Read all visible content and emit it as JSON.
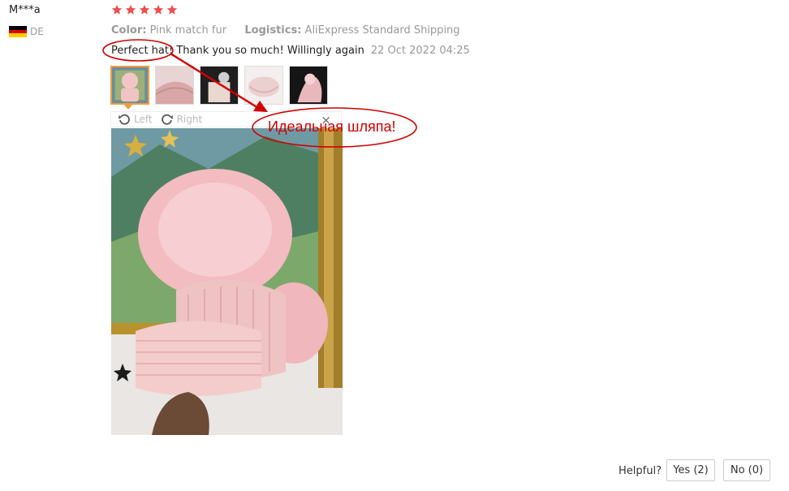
{
  "reviewer": {
    "name": "M***a",
    "country_code": "DE",
    "flag_colors": [
      "#000000",
      "#dd0000",
      "#ffce00"
    ]
  },
  "rating": {
    "stars": 5,
    "max": 5,
    "color": "#f04d4d"
  },
  "meta": {
    "color_label": "Color:",
    "color_value": "Pink match fur",
    "logistics_label": "Logistics:",
    "logistics_value": "AliExpress Standard Shipping"
  },
  "review": {
    "text": "Perfect hat! Thank you so much! Willingly again",
    "date": "22 Oct 2022 04:25"
  },
  "viewer": {
    "rotate_left": "Left",
    "rotate_right": "Right",
    "close": "×"
  },
  "annotation": {
    "text": "Идеальная шляпа!",
    "color": "#d00000"
  },
  "helpful": {
    "label": "Helpful?",
    "yes": "Yes (2)",
    "no": "No (0)"
  },
  "colors": {
    "accent": "#f39c3e",
    "muted": "#999999",
    "hat_pink": "#f0c4c4"
  }
}
